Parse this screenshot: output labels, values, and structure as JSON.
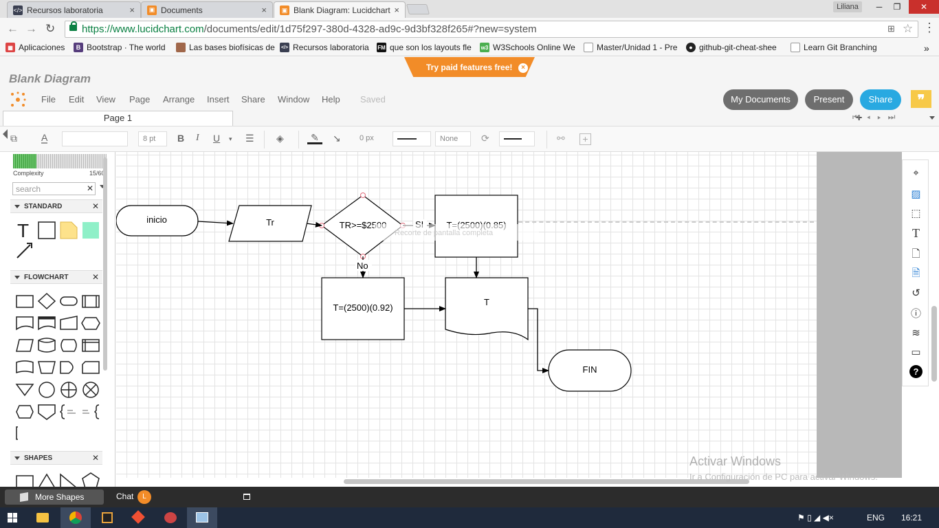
{
  "browser": {
    "tabs": [
      {
        "title": "Recursos laboratoria",
        "icon": "code-icon",
        "active": false
      },
      {
        "title": "Documents",
        "icon": "lucidchart-icon",
        "active": false
      },
      {
        "title": "Blank Diagram: Lucidchart",
        "icon": "lucidchart-icon",
        "active": true
      }
    ],
    "user": "Liliana",
    "url_prefix": "https://www.lucidchart.com",
    "url_rest": "/documents/edit/1d75f297-380d-4328-ad9c-9d3bf328f265#?new=system",
    "bookmarks": [
      "Aplicaciones",
      "Bootstrap · The world",
      "Las bases biofísicas de",
      "Recursos laboratoria",
      "que son los layouts fle",
      "W3Schools Online We",
      "Master/Unidad 1 - Pre",
      "github-git-cheat-shee",
      "Learn Git Branching"
    ],
    "bookmarks_overflow": "»"
  },
  "app": {
    "title": "Blank Diagram",
    "promo": "Try paid features free!",
    "menu": [
      "File",
      "Edit",
      "View",
      "Page",
      "Arrange",
      "Insert",
      "Share",
      "Window",
      "Help"
    ],
    "status": "Saved",
    "buttons": {
      "my_documents": "My Documents",
      "present": "Present",
      "share": "Share"
    },
    "colors": {
      "accent_orange": "#f28c28",
      "share_blue": "#29a9e1",
      "pill_gray": "#6e6e6e"
    },
    "page_tab": "Page 1"
  },
  "toolbar": {
    "font_size": "8 pt",
    "bold": "B",
    "italic": "I",
    "underline": "U",
    "line_width": "0 px",
    "endpoint": "None"
  },
  "left_panel": {
    "complexity_label": "Complexity",
    "complexity_value": "15/60",
    "complexity_fraction": 0.25,
    "search_placeholder": "search",
    "sections": {
      "standard": "STANDARD",
      "flowchart": "FLOWCHART",
      "shapes": "SHAPES"
    },
    "standard_text_shape": "T"
  },
  "diagram": {
    "nodes": {
      "inicio": "inicio",
      "tr": "Tr",
      "decision": "TR>=$2500",
      "calc_yes": "T=(2500)(0.85)",
      "calc_no": "T=(2500)(0.92)",
      "output": "T",
      "fin": "FIN"
    },
    "labels": {
      "yes": "SI",
      "no": "No"
    },
    "snip_overlay": "Recorte de pantalla completa"
  },
  "watermark": {
    "line1": "Activar Windows",
    "line2": "Ir a Configuración de PC para activar Windows."
  },
  "bottom_bar": {
    "more_shapes": "More Shapes",
    "chat": "Chat",
    "chat_avatar": "L"
  },
  "taskbar": {
    "language": "ENG",
    "time": "16:21"
  }
}
